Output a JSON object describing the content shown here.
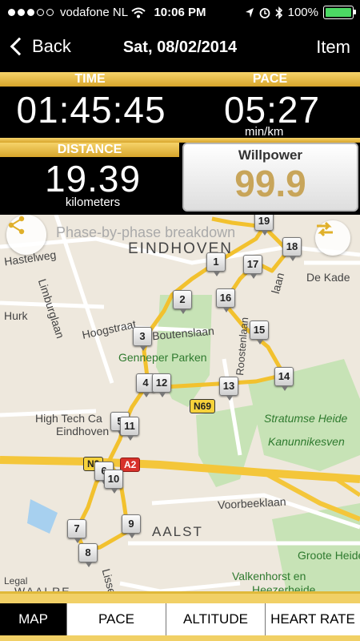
{
  "status_bar": {
    "carrier": "vodafone NL",
    "time": "10:06 PM",
    "battery": "100%"
  },
  "nav": {
    "back_label": "Back",
    "title": "Sat, 08/02/2014",
    "right_label": "Item"
  },
  "stats": {
    "time_label": "TIME",
    "time_value": "01:45:45",
    "pace_label": "PACE",
    "pace_value": "05:27",
    "pace_unit": "min/km",
    "distance_label": "DISTANCE",
    "distance_value": "19.39",
    "distance_unit": "kilometers",
    "willpower_label": "Willpower",
    "willpower_value": "99.9"
  },
  "map": {
    "overlay_text": "Phase-by-phase breakdown",
    "labels": {
      "city": "EINDHOVEN",
      "hastelweg": "Hastelweg",
      "limburglaan": "Limburglaan",
      "hurk": "Hurk",
      "hoogstraat": "Hoogstraat",
      "genneper": "Genneper Parken",
      "boutenslaan": "Boutenslaan",
      "high_tech": "High Tech Ca",
      "eindhoven2": "Eindhoven",
      "stratumse": "Stratumse Heide",
      "kanunnikesven": "Kanunnikesven",
      "de_kade": "De Kade",
      "voorbeeklaan": "Voorbeeklaan",
      "aalst": "AALST",
      "groote_heide": "Groote Heide",
      "valkenhorst": "Valkenhorst en",
      "heezerheide": "Heezerheide",
      "legal": "Legal",
      "waalre": "WAALRE",
      "lisseve": "Lisseve",
      "laan": "laan",
      "rootenlaan": "Roostenlaan"
    },
    "shields": {
      "n69": "N69",
      "n2": "N2",
      "a2": "A2"
    },
    "markers": [
      "1",
      "2",
      "3",
      "4",
      "5",
      "6",
      "7",
      "8",
      "9",
      "10",
      "11",
      "12",
      "13",
      "14",
      "15",
      "16",
      "17",
      "18",
      "19"
    ],
    "route_color": "#f2c12e"
  },
  "tabs": [
    {
      "label": "MAP",
      "active": true
    },
    {
      "label": "PACE",
      "active": false
    },
    {
      "label": "ALTITUDE",
      "active": false
    },
    {
      "label": "HEART RATE",
      "active": false
    }
  ],
  "icons": {
    "share": "share-icon",
    "swap": "swap-arrows-icon"
  }
}
